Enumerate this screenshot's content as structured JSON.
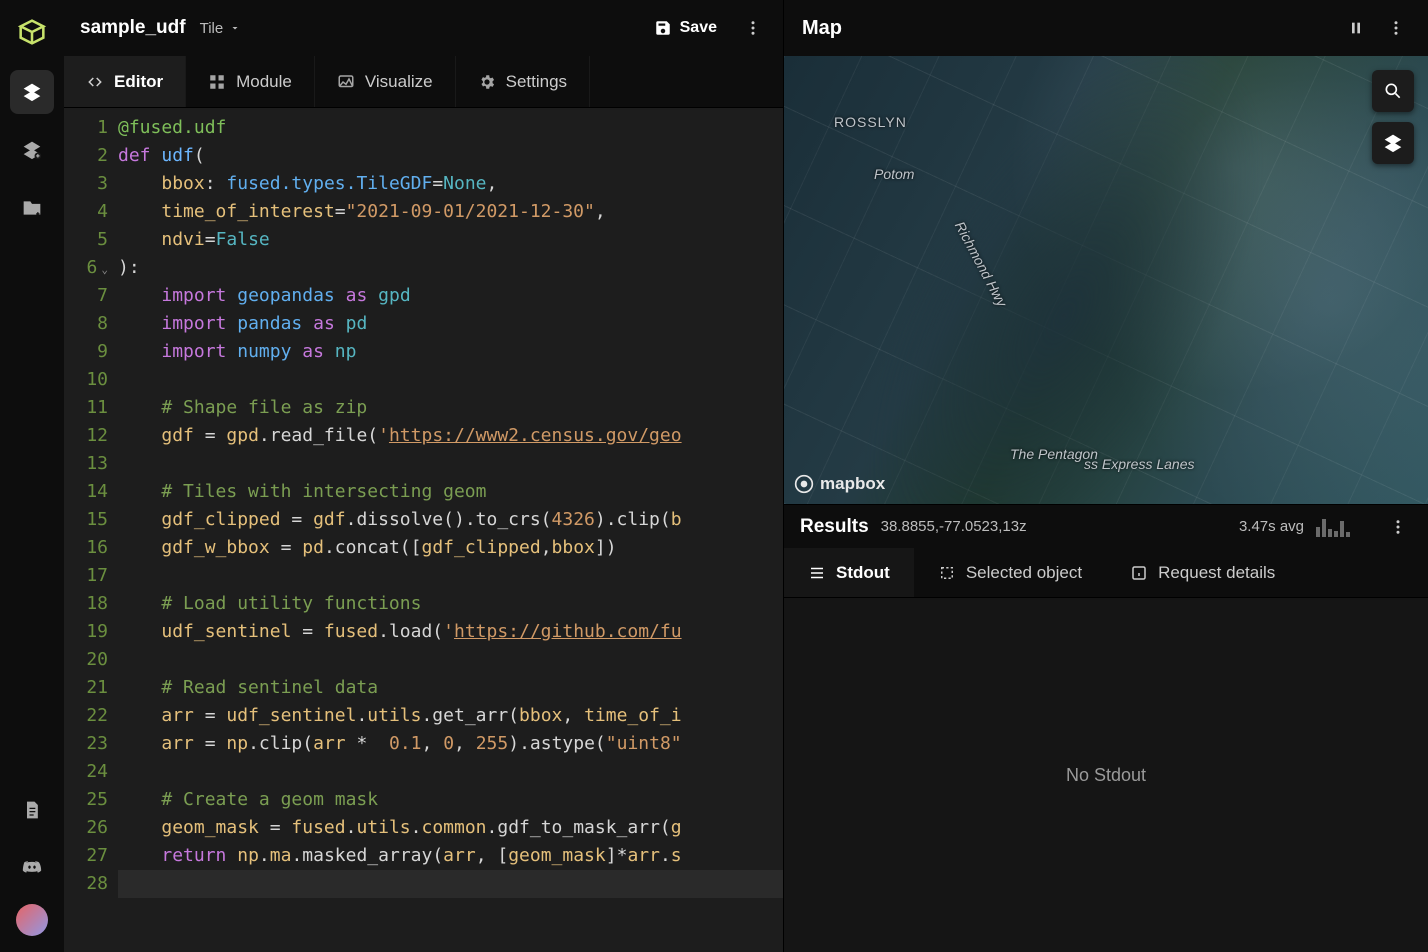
{
  "app": {
    "filename": "sample_udf",
    "mode_label": "Tile",
    "save_label": "Save"
  },
  "tabs": {
    "editor": "Editor",
    "module": "Module",
    "visualize": "Visualize",
    "settings": "Settings"
  },
  "code": {
    "raw": "@fused.udf\ndef udf(\n    bbox: fused.types.TileGDF=None,\n    time_of_interest=\"2021-09-01/2021-12-30\",\n    ndvi=False\n):\n    import geopandas as gpd\n    import pandas as pd\n    import numpy as np\n\n    # Shape file as zip\n    gdf = gpd.read_file('https://www2.census.gov/geo\n\n    # Tiles with intersecting geom\n    gdf_clipped = gdf.dissolve().to_crs(4326).clip(b\n    gdf_w_bbox = pd.concat([gdf_clipped,bbox])\n\n    # Load utility functions\n    udf_sentinel = fused.load('https://github.com/fu\n\n    # Read sentinel data\n    arr = udf_sentinel.utils.get_arr(bbox, time_of_i\n    arr = np.clip(arr *  0.1, 0, 255).astype(\"uint8\"\n\n    # Create a geom mask\n    geom_mask = fused.utils.common.gdf_to_mask_arr(g\n    return np.ma.masked_array(arr, [geom_mask]*arr.s\n",
    "line_count": 28
  },
  "map": {
    "title": "Map",
    "labels": {
      "rosslyn": "ROSSLYN",
      "potomac": "Potom",
      "pentagon": "The Pentagon",
      "richmond": "Richmond Hwy",
      "express": "ss Express Lanes"
    },
    "attribution": "mapbox"
  },
  "results": {
    "title": "Results",
    "coords": "38.8855,-77.0523,13z",
    "avg": "3.47s avg",
    "tabs": {
      "stdout": "Stdout",
      "selected": "Selected object",
      "request": "Request details"
    },
    "stdout_empty": "No Stdout"
  },
  "colors": {
    "accent_green": "#7fbf5a"
  }
}
